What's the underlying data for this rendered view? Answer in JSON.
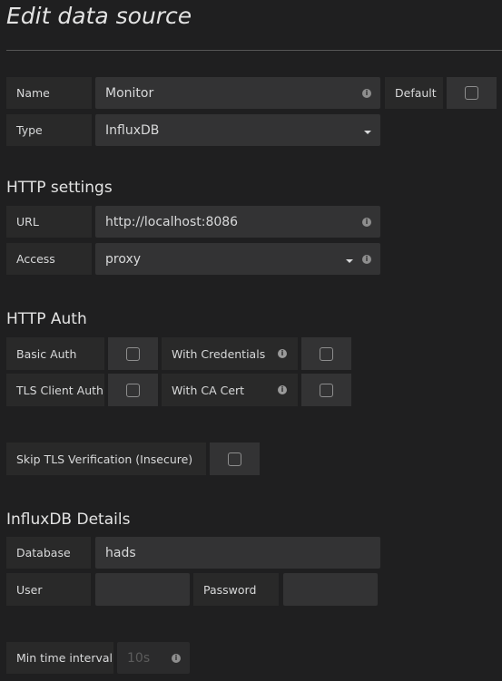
{
  "page": {
    "title": "Edit data source"
  },
  "general": {
    "name_label": "Name",
    "name_value": "Monitor",
    "default_label": "Default",
    "default_checked": false,
    "type_label": "Type",
    "type_value": "InfluxDB"
  },
  "http": {
    "heading": "HTTP settings",
    "url_label": "URL",
    "url_value": "http://localhost:8086",
    "access_label": "Access",
    "access_value": "proxy"
  },
  "auth": {
    "heading": "HTTP Auth",
    "basic_auth": "Basic Auth",
    "with_credentials": "With Credentials",
    "tls_client_auth": "TLS Client Auth",
    "with_ca_cert": "With CA Cert",
    "skip_tls": "Skip TLS Verification (Insecure)"
  },
  "influx": {
    "heading": "InfluxDB Details",
    "database_label": "Database",
    "database_value": "hads",
    "user_label": "User",
    "user_value": "",
    "password_label": "Password",
    "password_value": "",
    "min_interval_label": "Min time interval",
    "min_interval_placeholder": "10s"
  },
  "icons": {
    "info": "info-circle-icon",
    "caret": "caret-down-icon",
    "checkbox": "checkbox-unchecked"
  }
}
